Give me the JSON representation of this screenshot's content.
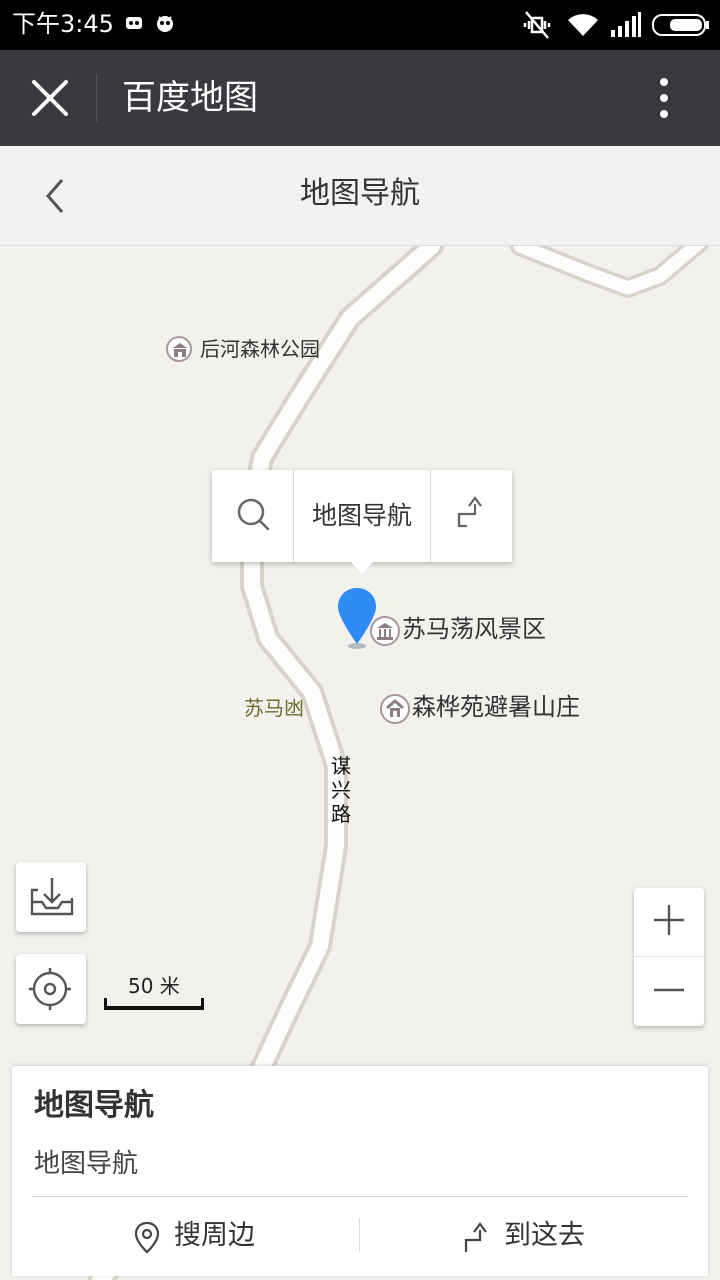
{
  "status_bar": {
    "time": "下午3:45"
  },
  "wechat_bar": {
    "title": "百度地图"
  },
  "page": {
    "title": "地图导航"
  },
  "map": {
    "pois": [
      {
        "label": "后河森林公园"
      },
      {
        "label": "苏马荡风景区"
      },
      {
        "label": "森桦苑避暑山庄"
      }
    ],
    "area_label": "苏马凼",
    "road_label": [
      "谋",
      "兴",
      "路"
    ],
    "popup_text": "地图导航",
    "scale": "50 米",
    "pin_color": "#2f8cf6"
  },
  "sheet": {
    "title": "地图导航",
    "subtitle": "地图导航",
    "actions": {
      "nearby": "搜周边",
      "goto": "到这去"
    }
  }
}
